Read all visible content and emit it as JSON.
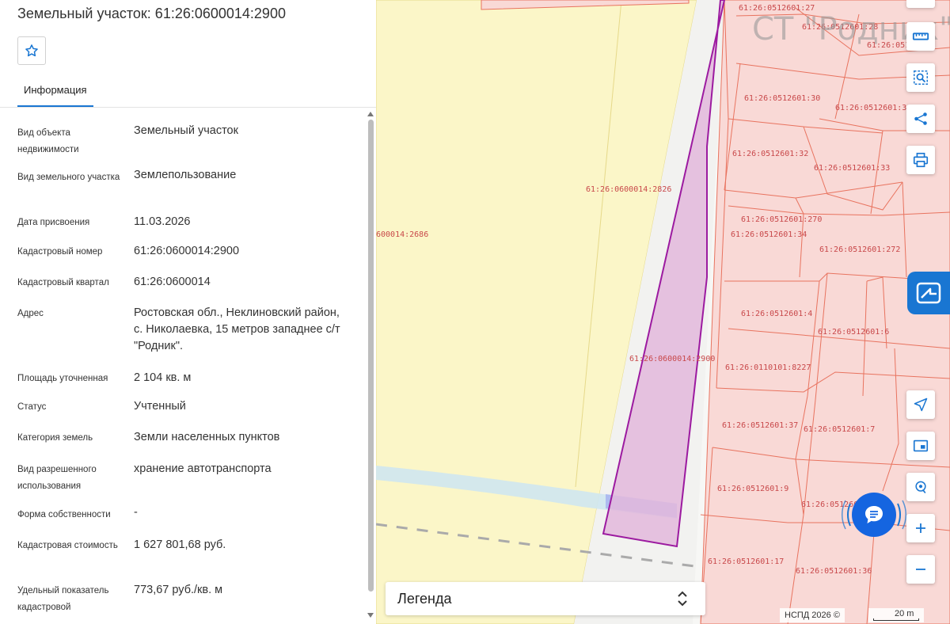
{
  "panel": {
    "title": "Земельный участок: 61:26:0600014:2900",
    "tab_info": "Информация",
    "properties": [
      {
        "label": "Вид объекта недвижимости",
        "value": "Земельный участок"
      },
      {
        "label": "Вид земельного участка",
        "value": "Землепользование"
      },
      {
        "label": "Дата присвоения",
        "value": "11.03.2026"
      },
      {
        "label": "Кадастровый номер",
        "value": "61:26:0600014:2900"
      },
      {
        "label": "Кадастровый квартал",
        "value": "61:26:0600014"
      },
      {
        "label": "Адрес",
        "value": "Ростовская обл., Неклиновский район, с. Николаевка, 15 метров западнее с/т \"Родник\"."
      },
      {
        "label": "Площадь уточненная",
        "value": "2 104 кв. м"
      },
      {
        "label": "Статус",
        "value": "Учтенный"
      },
      {
        "label": "Категория земель",
        "value": "Земли населенных пунктов"
      },
      {
        "label": "Вид разрешенного использования",
        "value": "хранение автотранспорта"
      },
      {
        "label": "Форма собственности",
        "value": "-"
      },
      {
        "label": "Кадастровая стоимость",
        "value": "1 627 801,68 руб."
      },
      {
        "label": "Удельный показатель кадастровой",
        "value": "773,67 руб./кв. м"
      }
    ]
  },
  "map": {
    "labels": {
      "p2686": "600014:2686",
      "p2826": "61:26:0600014:2826",
      "p2900": "61:26:0600014:2900",
      "p27": "61:26:0512601:27",
      "p28": "61:26:0512601:28",
      "p29": "61:26:051",
      "p30": "61:26:0512601:30",
      "p31": "61:26:0512601:31",
      "p32": "61:26:0512601:32",
      "p33": "61:26:0512601:33",
      "p270": "61:26:0512601:270",
      "p34": "61:26:0512601:34",
      "p272": "61:26:0512601:272",
      "p4": "61:26:0512601:4",
      "p6": "61:26:0512601:6",
      "p8227": "61:26:0110101:8227",
      "p37": "61:26:0512601:37",
      "p7": "61:26:0512601:7",
      "p9": "61:26:0512601:9",
      "p250": "61:26:0512601",
      "p17": "61:26:0512601:17",
      "p36": "61:26:0512601:36",
      "st": "СТ \"Родник\""
    },
    "legend_label": "Легенда",
    "copyright": "НСПД 2026 ©",
    "scale_label": "20 m"
  },
  "colors": {
    "accent": "#1976d2",
    "selected_fill": "#e3b8dc",
    "selected_stroke": "#9c1aa0",
    "parcel_fill": "#f9d9d6",
    "parcel_stroke": "#e8735f",
    "yellow_area": "#fbf6c8"
  },
  "icons": [
    "star-icon",
    "ruler-icon",
    "selection-search-icon",
    "share-icon",
    "print-icon",
    "pkk-logo-icon",
    "navigate-icon",
    "minimap-icon",
    "geolocation-icon",
    "zoom-in-icon",
    "zoom-out-icon",
    "chat-icon",
    "chevron-updown-icon"
  ]
}
